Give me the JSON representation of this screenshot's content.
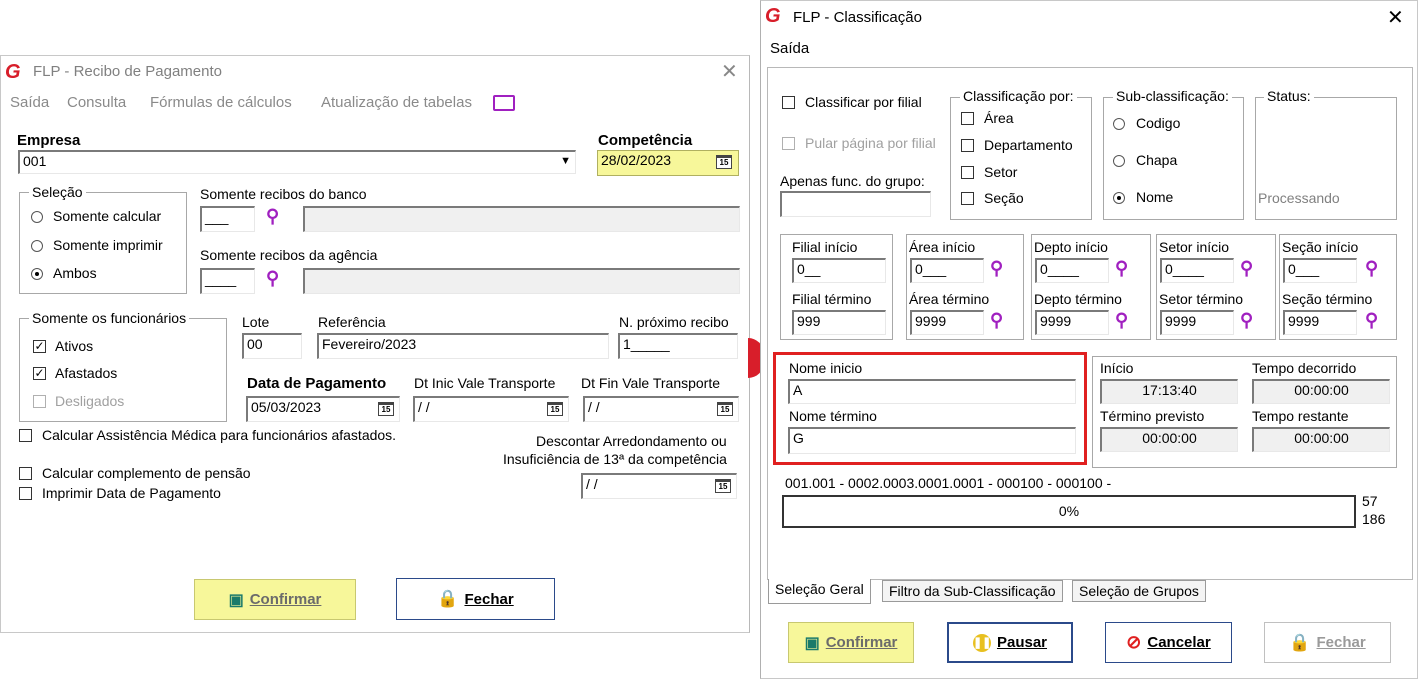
{
  "recibo": {
    "title": "FLP - Recibo de Pagamento",
    "menu": [
      "Saída",
      "Consulta",
      "Fórmulas de cálculos",
      "Atualização de tabelas"
    ],
    "empresa_label": "Empresa",
    "empresa_value": "001",
    "competencia_label": "Competência",
    "competencia_value": "28/02/2023",
    "selecao_title": "Seleção",
    "selecao_options": [
      "Somente calcular",
      "Somente imprimir",
      "Ambos"
    ],
    "banco_label": "Somente recibos do banco",
    "agencia_label": "Somente recibos da agência",
    "funcionarios_title": "Somente os funcionários",
    "func_ativos": "Ativos",
    "func_afastados": "Afastados",
    "func_desligados": "Desligados",
    "lote_label": "Lote",
    "lote_value": "00",
    "referencia_label": "Referência",
    "referencia_value": "Fevereiro/2023",
    "proximo_label": "N. próximo recibo",
    "proximo_value": "1_____",
    "data_pag_label": "Data de Pagamento",
    "data_pag_value": "05/03/2023",
    "vt_inic_label": "Dt Inic Vale Transporte",
    "vt_inic_value": "/ /",
    "vt_fin_label": "Dt Fin Vale Transporte",
    "vt_fin_value": "/ /",
    "assist_label": "Calcular Assistência Médica para funcionários afastados.",
    "desconto_label_1": "Descontar Arredondamento ou",
    "desconto_label_2": "Insuficiência de 13ª da competência",
    "desconto_value": "/ /",
    "pensao_label": "Calcular complemento de pensão",
    "imprimir_label": "Imprimir Data de Pagamento",
    "confirmar": "Confirmar",
    "fechar": "Fechar",
    "cal_text": "15"
  },
  "classif": {
    "title": "FLP - Classificação",
    "menu_saida": "Saída",
    "classificar_filial": "Classificar por filial",
    "pular_pagina": "Pular página por filial",
    "apenas_grupo": "Apenas func. do grupo:",
    "classif_por_title": "Classificação  por:",
    "classif_por": [
      "Área",
      "Departamento",
      "Setor",
      "Seção"
    ],
    "sub_title": "Sub-classificação:",
    "sub_options": [
      "Codigo",
      "Chapa",
      "Nome"
    ],
    "status_title": "Status:",
    "status_value": "Processando",
    "ranges": [
      {
        "ini_label": "Filial início",
        "ini_value": "0__",
        "fim_label": "Filial término",
        "fim_value": "999"
      },
      {
        "ini_label": "Área início",
        "ini_value": "0___",
        "fim_label": "Área término",
        "fim_value": "9999"
      },
      {
        "ini_label": "Depto início",
        "ini_value": "0____",
        "fim_label": "Depto término",
        "fim_value": "9999"
      },
      {
        "ini_label": "Setor início",
        "ini_value": "0____",
        "fim_label": "Setor término",
        "fim_value": "9999"
      },
      {
        "ini_label": "Seção início",
        "ini_value": "0___",
        "fim_label": "Seção término",
        "fim_value": "9999"
      }
    ],
    "nome_inicio_label": "Nome inicio",
    "nome_inicio_value": "A",
    "nome_termino_label": "Nome término",
    "nome_termino_value": "G",
    "inicio_label": "Início",
    "inicio_value": "17:13:40",
    "decorrido_label": "Tempo decorrido",
    "decorrido_value": "00:00:00",
    "termino_prev_label": "Término previsto",
    "termino_prev_value": "00:00:00",
    "restante_label": "Tempo restante",
    "restante_value": "00:00:00",
    "progress_text": "001.001 - 0002.0003.0001.0001 - 000100 - 000100 -",
    "progress_percent": "0%",
    "count_a": "57",
    "count_b": "186",
    "tabs": [
      "Seleção Geral",
      "Filtro da Sub-Classificação",
      "Seleção de Grupos"
    ],
    "btn_confirmar": "Confirmar",
    "btn_pausar": "Pausar",
    "btn_cancelar": "Cancelar",
    "btn_fechar": "Fechar"
  },
  "colors": {
    "accent_yellow": "#f7f79a",
    "highlight_red": "#e02020",
    "icon_purple": "#a020c0",
    "logo_red": "#d81e2a"
  }
}
